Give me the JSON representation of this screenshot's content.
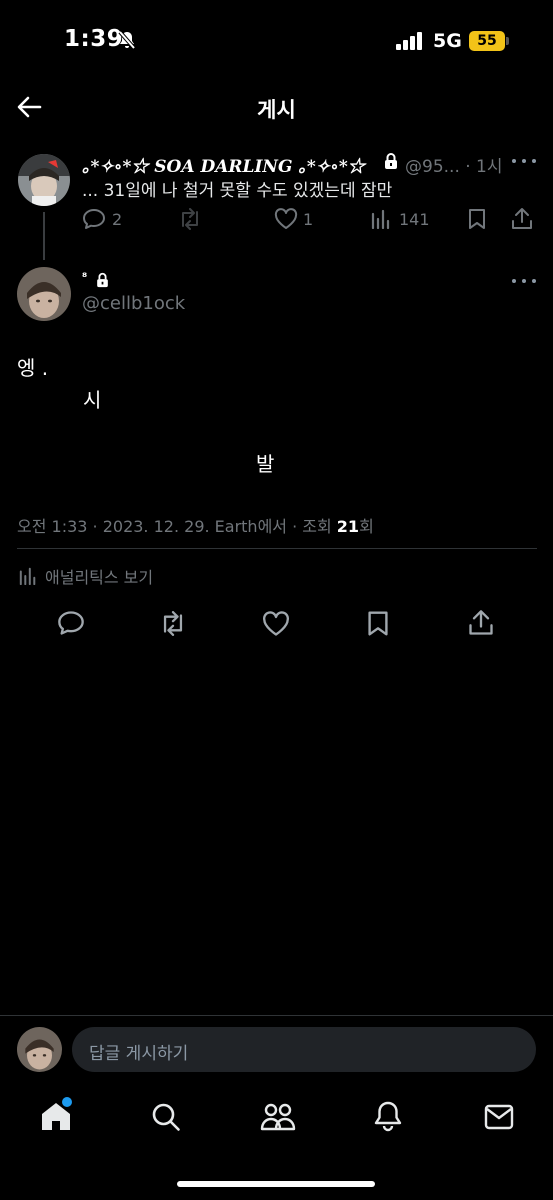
{
  "status_bar": {
    "time": "1:39",
    "network": "5G",
    "battery": "55"
  },
  "header": {
    "title": "게시"
  },
  "quoted_post": {
    "display_name": "｡*✧∘*☆ SOA DARLING ｡*✧∘*☆",
    "handle_time": "@95... · 1시",
    "text": "... 31일에 나 철거 못할 수도 있겠는데 잠만",
    "actions": {
      "replies": "2",
      "likes": "1",
      "views": "141"
    }
  },
  "main_post": {
    "display_name": "⁸",
    "handle": "@cellb1ock",
    "lines": [
      "엥 .",
      "시",
      "발"
    ],
    "meta": {
      "prefix": "오전 1:33 · 2023. 12. 29. Earth에서 · 조회 ",
      "views": "21",
      "suffix": "회"
    },
    "analytics_label": "애널리틱스 보기"
  },
  "reply_bar": {
    "placeholder": "답글 게시하기"
  },
  "colors": {
    "background": "#000000",
    "muted": "#71767b",
    "notification_dot": "#1d9bf0",
    "battery": "#f2c318"
  },
  "icons": [
    "bell-slash-icon",
    "back-arrow-icon",
    "lock-icon",
    "more-icon",
    "reply-icon",
    "retweet-icon",
    "like-icon",
    "views-icon",
    "bookmark-icon",
    "share-icon",
    "analytics-icon",
    "home-icon",
    "search-icon",
    "communities-icon",
    "notifications-icon",
    "messages-icon"
  ]
}
